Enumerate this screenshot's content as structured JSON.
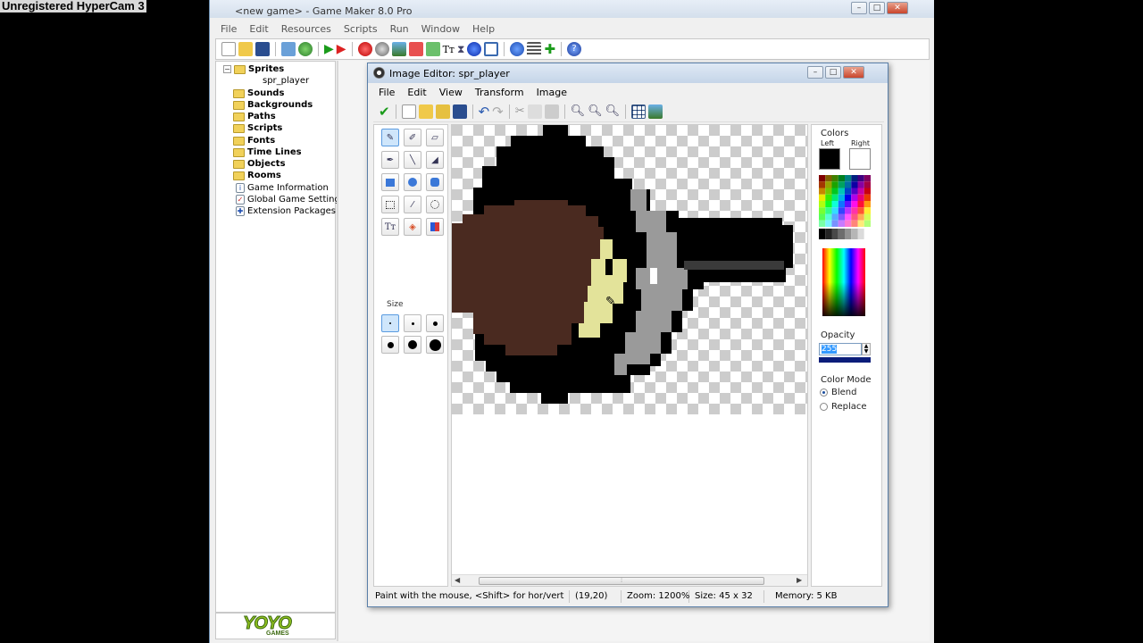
{
  "watermark": "Unregistered HyperCam 3",
  "gm_window": {
    "title": "<new game> - Game Maker 8.0 Pro",
    "menu": [
      "File",
      "Edit",
      "Resources",
      "Scripts",
      "Run",
      "Window",
      "Help"
    ]
  },
  "tree": {
    "sprites": "Sprites",
    "sprite_child": "spr_player",
    "sounds": "Sounds",
    "backgrounds": "Backgrounds",
    "paths": "Paths",
    "scripts": "Scripts",
    "fonts": "Fonts",
    "time_lines": "Time Lines",
    "objects": "Objects",
    "rooms": "Rooms",
    "game_information": "Game Information",
    "global_game_settings": "Global Game Settings",
    "extension_packages": "Extension Packages"
  },
  "logo": {
    "main": "YOYO",
    "sub": "GAMES"
  },
  "editor": {
    "title": "Image Editor: spr_player",
    "menu": [
      "File",
      "Edit",
      "View",
      "Transform",
      "Image"
    ],
    "size_label": "Size",
    "colors": {
      "heading": "Colors",
      "left_label": "Left",
      "right_label": "Right",
      "left_color": "#000000",
      "right_color": "#ffffff"
    },
    "opacity": {
      "label": "Opacity",
      "value": "255"
    },
    "color_mode": {
      "label": "Color Mode",
      "options": [
        "Blend",
        "Replace"
      ],
      "selected": "Blend"
    },
    "status": {
      "hint": "Paint with the mouse, <Shift> for hor/vert",
      "coords": "(19,20)",
      "zoom": "Zoom: 1200%",
      "size": "Size: 45 x 32",
      "memory": "Memory: 5 KB"
    }
  },
  "sprite_colors": {
    "hair": "#4a2a20",
    "face": "#e3e39a",
    "outline": "#000000",
    "pan": "#9a9a9a",
    "handle": "#3a3a3a"
  }
}
